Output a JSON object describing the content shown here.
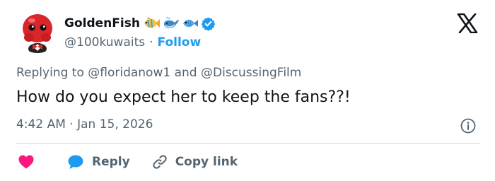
{
  "tweet": {
    "author": {
      "display_name": "GoldenFish",
      "handle": "@100kuwaits",
      "name_emojis": [
        "tropical-fish-emoji",
        "whale-emoji",
        "fish-emoji"
      ],
      "verified": true
    },
    "follow_label": "Follow",
    "separator": "·",
    "replying_prefix": "Replying to",
    "replying_conjunction": "and",
    "mentions": [
      "@floridanow1",
      "@DiscussingFilm"
    ],
    "text": "How do you expect her to keep the fans??!",
    "timestamp": "4:42 AM · Jan 15, 2026"
  },
  "actions": {
    "like_icon": "heart-icon",
    "reply_label": "Reply",
    "copy_label": "Copy link"
  },
  "colors": {
    "accent": "#1d9bf0",
    "like": "#f91880",
    "secondary_text": "#536471",
    "primary_text": "#0f1419",
    "divider": "#cfd9de"
  }
}
